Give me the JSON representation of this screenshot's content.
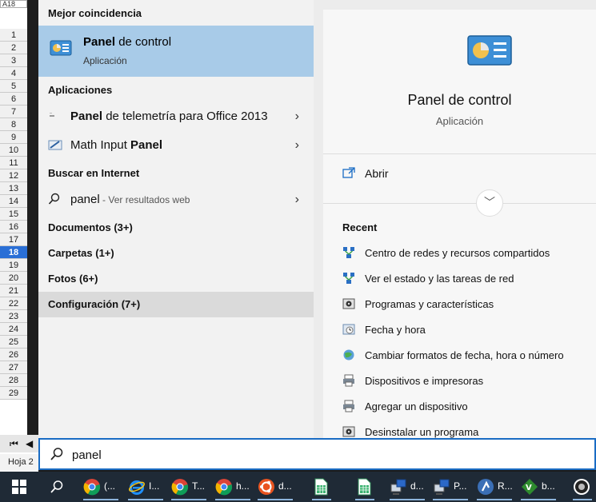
{
  "spreadsheet": {
    "cell_ref": "A18",
    "rows": [
      "1",
      "2",
      "3",
      "4",
      "5",
      "6",
      "7",
      "8",
      "9",
      "10",
      "11",
      "12",
      "13",
      "14",
      "15",
      "16",
      "17",
      "18",
      "19",
      "20",
      "21",
      "22",
      "23",
      "24",
      "25",
      "26",
      "27",
      "28",
      "29"
    ],
    "active_row": "18",
    "sheet_tab": "Hoja 2"
  },
  "search_results": {
    "best_match_heading": "Mejor coincidencia",
    "best_match": {
      "title_bold": "Panel",
      "title_rest": " de control",
      "subtitle": "Aplicación"
    },
    "apps_heading": "Aplicaciones",
    "apps": [
      {
        "bold": "Panel",
        "rest": " de telemetría para Office 2013"
      },
      {
        "pre": "Math Input ",
        "bold": "Panel"
      }
    ],
    "web_heading": "Buscar en Internet",
    "web_item": {
      "query": "panel",
      "hint": " - Ver resultados web"
    },
    "categories": [
      "Documentos (3+)",
      "Carpetas (1+)",
      "Fotos (6+)",
      "Configuración (7+)"
    ]
  },
  "preview": {
    "title": "Panel de control",
    "subtitle": "Aplicación",
    "open_label": "Abrir",
    "recent_heading": "Recent",
    "recent": [
      {
        "label": "Centro de redes y recursos compartidos",
        "icon": "network-icon"
      },
      {
        "label": "Ver el estado y las tareas de red",
        "icon": "network-icon"
      },
      {
        "label": "Programas y características",
        "icon": "programs-icon"
      },
      {
        "label": "Fecha y hora",
        "icon": "clock-icon"
      },
      {
        "label": "Cambiar formatos de fecha, hora o número",
        "icon": "globe-icon"
      },
      {
        "label": "Dispositivos e impresoras",
        "icon": "printer-icon"
      },
      {
        "label": "Agregar un dispositivo",
        "icon": "printer-icon"
      },
      {
        "label": "Desinstalar un programa",
        "icon": "programs-icon"
      }
    ]
  },
  "search_box": {
    "value": "panel"
  },
  "taskbar": {
    "items": [
      {
        "label": "(...",
        "icon": "chrome-icon"
      },
      {
        "label": "I...",
        "icon": "ie-icon"
      },
      {
        "label": "T...",
        "icon": "chrome-icon"
      },
      {
        "label": "h...",
        "icon": "chrome-icon"
      },
      {
        "label": "d...",
        "icon": "ubuntu-icon"
      },
      {
        "label": "",
        "icon": "calc-icon"
      },
      {
        "label": "",
        "icon": "calc-icon"
      },
      {
        "label": "d...",
        "icon": "remote-icon"
      },
      {
        "label": "P...",
        "icon": "remote-icon"
      },
      {
        "label": "R...",
        "icon": "r-icon"
      },
      {
        "label": "b...",
        "icon": "vim-icon"
      },
      {
        "label": "",
        "icon": "obs-icon"
      }
    ]
  },
  "colors": {
    "accent": "#1a6cc4",
    "selection": "#a8cbe8",
    "taskbar": "#1f2a36"
  }
}
